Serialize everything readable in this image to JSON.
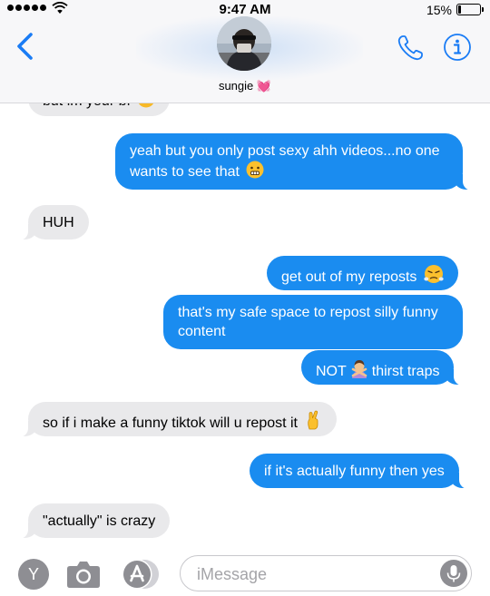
{
  "status_bar": {
    "time": "9:47 AM",
    "battery_percent": "15%",
    "battery_level": 0.15,
    "signal_dots": 5,
    "wifi_icon": "wifi-icon"
  },
  "header": {
    "contact_name": "sungie",
    "name_emoji": "💓",
    "accent_color": "#1a7cf5",
    "icons": [
      "back-chevron-icon",
      "phone-icon",
      "info-icon"
    ]
  },
  "messages": [
    {
      "from": "recv",
      "text": "but im your bf",
      "emoji": "upset-face-emoji",
      "partial": true
    },
    {
      "from": "sent",
      "text": "yeah but you only post sexy ahh videos...no one wants to see that",
      "emoji": "grimace-emoji"
    },
    {
      "from": "recv",
      "text": "HUH"
    },
    {
      "from": "sent",
      "text": "get out of my reposts",
      "emoji": "steam-face-emoji"
    },
    {
      "from": "sent",
      "text": "that's my safe space to repost silly funny content"
    },
    {
      "from": "sent",
      "text_before": "NOT",
      "text_after": "thirst traps",
      "emoji": "person-gesturing-no-emoji"
    },
    {
      "from": "recv",
      "text": "so if i make a funny tiktok will u repost it",
      "emoji": "crossed-fingers-emoji"
    },
    {
      "from": "sent",
      "text": "if it's actually funny then yes"
    },
    {
      "from": "recv",
      "text": "\"actually\" is crazy"
    }
  ],
  "input_bar": {
    "placeholder": "iMessage",
    "app_buttons": [
      {
        "name": "yahoo-app",
        "label": "Y"
      },
      {
        "name": "camera",
        "icon": "camera-icon"
      },
      {
        "name": "app-store",
        "icon": "app-store-icon"
      }
    ],
    "mic_icon": "microphone-icon"
  },
  "colors": {
    "sent_bubble": "#1a8cf0",
    "received_bubble": "#e9e9eb",
    "header_bg": "#f7f7f9"
  }
}
